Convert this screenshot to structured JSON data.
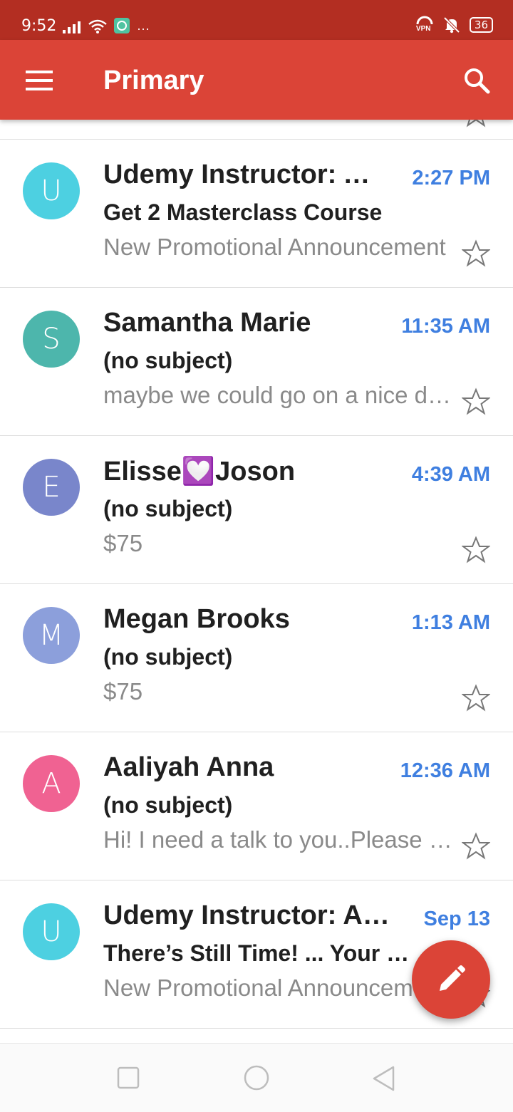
{
  "status_bar": {
    "time": "9:52",
    "battery": "36",
    "vpn_label": "VPN",
    "more_label": "···"
  },
  "app_bar": {
    "title": "Primary"
  },
  "colors": {
    "app_bar": "#db4437",
    "status_bar": "#b32e22",
    "time_accent": "#3f7fe0"
  },
  "emails": [
    {
      "initial": "U",
      "avatar_color": "#4dd0e1",
      "sender": "Udemy Instructor: Amar Khan",
      "time": "2:27 PM",
      "subject": "Get 2 Masterclass Course",
      "snippet": "New Promotional Announcement"
    },
    {
      "initial": "S",
      "avatar_color": "#4db6ac",
      "sender": "Samantha Marie",
      "time": "11:35 AM",
      "subject": "(no subject)",
      "snippet": "maybe we could go on a nice date"
    },
    {
      "initial": "E",
      "avatar_color": "#7986cb",
      "sender": "Elisse💟Joson",
      "time": "4:39 AM",
      "subject": "(no subject)",
      "snippet": "$75"
    },
    {
      "initial": "M",
      "avatar_color": "#8c9fdb",
      "sender": "Megan Brooks",
      "time": "1:13 AM",
      "subject": "(no subject)",
      "snippet": "$75"
    },
    {
      "initial": "A",
      "avatar_color": "#f06292",
      "sender": "Aaliyah Anna",
      "time": "12:36 AM",
      "subject": "(no subject)",
      "snippet": "Hi! I need a talk to you..Please reply"
    },
    {
      "initial": "U",
      "avatar_color": "#4dd0e1",
      "sender": "Udemy Instructor: Amar Khan",
      "time": "Sep 13",
      "subject": "There’s Still Time! ... Your Course",
      "snippet": "New Promotional Announcement"
    }
  ]
}
